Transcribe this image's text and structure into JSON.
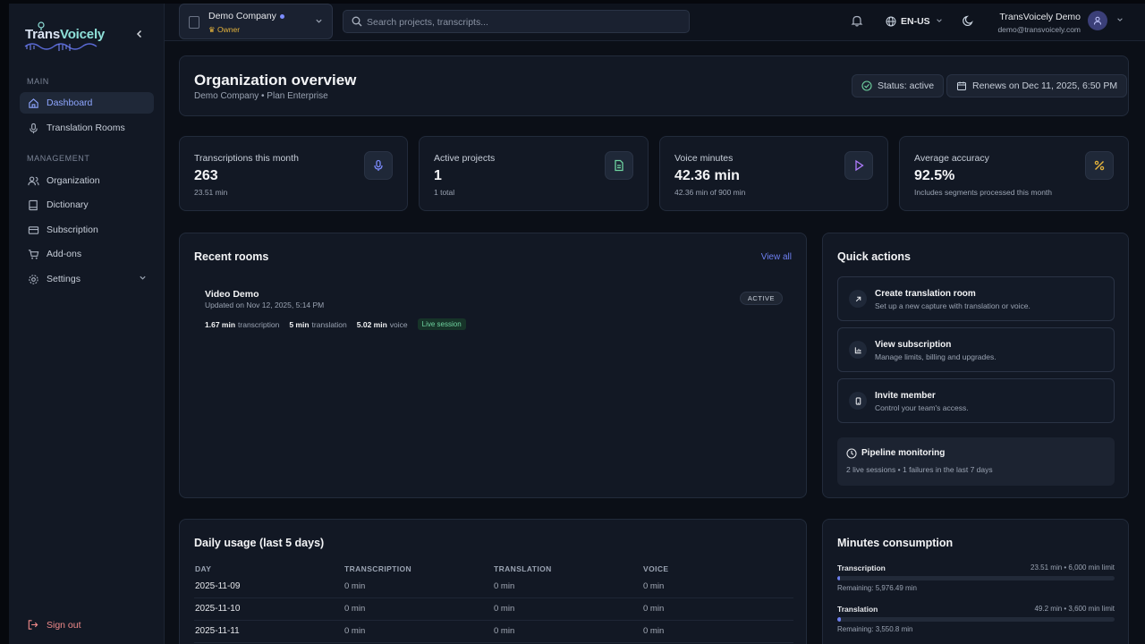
{
  "brand": {
    "logo_text_a": "Trans",
    "logo_text_b": "Voicely"
  },
  "sidebar": {
    "sections": [
      {
        "label": "MAIN"
      },
      {
        "label": "MANAGEMENT"
      }
    ],
    "items": [
      {
        "label": "Dashboard",
        "icon": "home-icon"
      },
      {
        "label": "Translation Rooms",
        "icon": "mic-icon"
      },
      {
        "label": "Organization",
        "icon": "users-icon"
      },
      {
        "label": "Dictionary",
        "icon": "book-icon"
      },
      {
        "label": "Subscription",
        "icon": "card-icon"
      },
      {
        "label": "Add-ons",
        "icon": "cart-icon"
      },
      {
        "label": "Settings",
        "icon": "gear-icon"
      }
    ],
    "signout_label": "Sign out"
  },
  "header": {
    "org_name": "Demo Company",
    "org_role": "Owner",
    "search_placeholder": "Search projects, transcripts...",
    "language": "EN-US",
    "user_name": "TransVoicely Demo",
    "user_email": "demo@transvoicely.com"
  },
  "overview": {
    "title": "Organization overview",
    "subtitle": "Demo Company • Plan Enterprise",
    "status": "Status: active",
    "renews": "Renews on Dec 11, 2025, 6:50 PM"
  },
  "stats": [
    {
      "label": "Transcriptions this month",
      "value": "263",
      "hint": "23.51 min",
      "icon": "mic-icon"
    },
    {
      "label": "Active projects",
      "value": "1",
      "hint": "1 total",
      "icon": "file-icon"
    },
    {
      "label": "Voice minutes",
      "value": "42.36 min",
      "hint": "42.36 min of 900 min",
      "icon": "play-icon"
    },
    {
      "label": "Average accuracy",
      "value": "92.5%",
      "hint": "Includes segments processed this month",
      "icon": "percent-icon"
    }
  ],
  "recent_rooms": {
    "title": "Recent rooms",
    "view_all": "View all",
    "rooms": [
      {
        "name": "Video Demo",
        "updated": "Updated on Nov 12, 2025, 5:14 PM",
        "status": "ACTIVE",
        "transcription_value": "1.67 min",
        "transcription_label": "transcription",
        "translation_value": "5 min",
        "translation_label": "translation",
        "voice_value": "5.02 min",
        "voice_label": "voice",
        "live": "Live session"
      }
    ]
  },
  "quick_actions": {
    "title": "Quick actions",
    "actions": [
      {
        "title": "Create translation room",
        "sub": "Set up a new capture with translation or voice.",
        "icon": "arrow-up-right-icon"
      },
      {
        "title": "View subscription",
        "sub": "Manage limits, billing and upgrades.",
        "icon": "bar-chart-icon"
      },
      {
        "title": "Invite member",
        "sub": "Control your team's access.",
        "icon": "phone-icon"
      }
    ],
    "pipeline_title": "Pipeline monitoring",
    "pipeline_sub": "2 live sessions • 1 failures in the last 7 days"
  },
  "daily_usage": {
    "title": "Daily usage (last 5 days)",
    "columns": [
      "DAY",
      "TRANSCRIPTION",
      "TRANSLATION",
      "VOICE"
    ],
    "rows": [
      [
        "2025-11-09",
        "0 min",
        "0 min",
        "0 min"
      ],
      [
        "2025-11-10",
        "0 min",
        "0 min",
        "0 min"
      ],
      [
        "2025-11-11",
        "0 min",
        "0 min",
        "0 min"
      ]
    ]
  },
  "minutes_consumption": {
    "title": "Minutes consumption",
    "rows": [
      {
        "label": "Transcription",
        "value": "23.51 min • 6,000 min limit",
        "remaining": "Remaining: 5,976.49 min",
        "fraction": 0.004
      },
      {
        "label": "Translation",
        "value": "49.2 min • 3,600 min limit",
        "remaining": "Remaining: 3,550.8 min",
        "fraction": 0.014
      }
    ]
  },
  "colors": {
    "accent": "#6d7ff0",
    "success": "#6fd3a0",
    "danger": "#f08a8a",
    "owner": "#e3b23c"
  }
}
